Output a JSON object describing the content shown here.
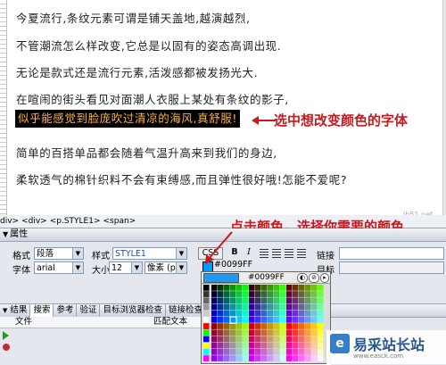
{
  "content": {
    "lines": [
      "今夏流行,条纹元素可谓是铺天盖地,越演越烈,",
      "不管潮流怎么样改变,它总是以固有的姿态高调出现.",
      "无论是款式还是流行元素,活泼感都被发扬光大.",
      "在喧闹的街头看见对面潮人衣服上某处有条纹的影子,",
      "简单的百搭单品都会随着气温升高来到我们的身边,",
      "柔软透气的棉针织料不会有束缚感,而且弹性很好哦!怎能不爱呢?"
    ],
    "highlight": "似乎能感觉到脸庞吹过清凉的海风,真舒服!"
  },
  "annotations": {
    "select_text": "选中想改变颜色的字体",
    "click_color": "点击颜色，选择你需要的颜色"
  },
  "status": {
    "tags": [
      "div>",
      "<div>",
      "<p.STYLE1>",
      "<span>"
    ]
  },
  "props": {
    "title": "属性",
    "format_label": "格式",
    "format_value": "段落",
    "style_label": "样式",
    "style_value": "STYLE1",
    "css_button": "CSS",
    "bold_button": "B",
    "italic_button": "I",
    "link_label": "链接",
    "font_label": "字体",
    "font_value": "arial",
    "size_label": "大小",
    "size_value": "12",
    "unit_value": "像素 (px)",
    "color_hex": "#0099FF",
    "target_label": "目标"
  },
  "palette": {
    "hex": "#0099FF"
  },
  "results": {
    "tabs": [
      "结果",
      "搜索",
      "参考",
      "验证",
      "目标浏览器检查",
      "链接检查"
    ],
    "col_file": "文件",
    "col_match": "匹配文本"
  },
  "logo": {
    "text": "易采站长站",
    "sub": "www.easck.com"
  },
  "watermark": "jb51.net",
  "colors": {
    "highlight_text": "#ffb43c",
    "annotation": "#c8181e",
    "selected_color": "#0099ff"
  }
}
